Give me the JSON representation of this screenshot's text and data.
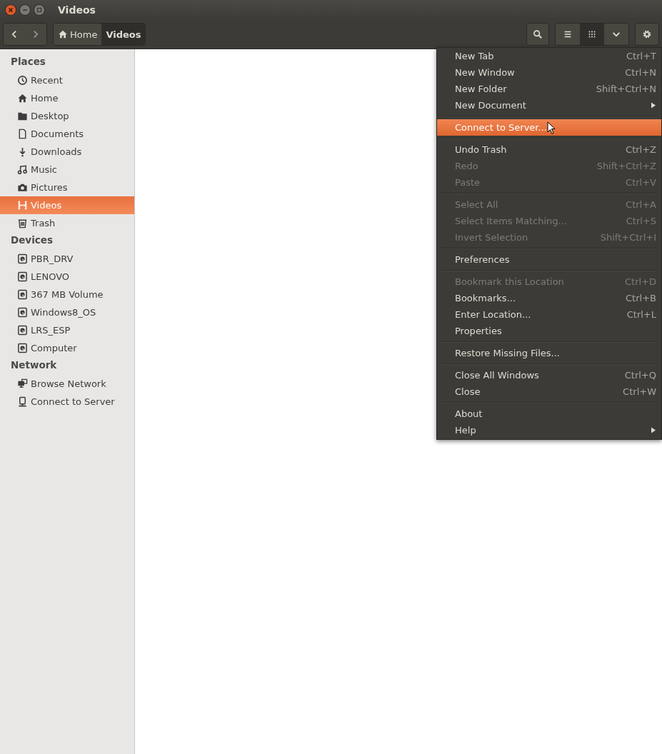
{
  "window": {
    "title": "Videos"
  },
  "toolbar": {
    "breadcrumbs": [
      {
        "label": "Home",
        "selected": false
      },
      {
        "label": "Videos",
        "selected": true
      }
    ],
    "view_buttons": [
      {
        "kind": "list",
        "selected": false
      },
      {
        "kind": "grid",
        "selected": true
      },
      {
        "kind": "chevron",
        "selected": false
      }
    ]
  },
  "sidebar": {
    "sections": [
      {
        "title": "Places",
        "items": [
          {
            "label": "Recent",
            "selected": false
          },
          {
            "label": "Home",
            "selected": false
          },
          {
            "label": "Desktop",
            "selected": false
          },
          {
            "label": "Documents",
            "selected": false
          },
          {
            "label": "Downloads",
            "selected": false
          },
          {
            "label": "Music",
            "selected": false
          },
          {
            "label": "Pictures",
            "selected": false
          },
          {
            "label": "Videos",
            "selected": true
          },
          {
            "label": "Trash",
            "selected": false
          }
        ]
      },
      {
        "title": "Devices",
        "items": [
          {
            "label": "PBR_DRV",
            "selected": false
          },
          {
            "label": "LENOVO",
            "selected": false
          },
          {
            "label": "367 MB Volume",
            "selected": false
          },
          {
            "label": "Windows8_OS",
            "selected": false
          },
          {
            "label": "LRS_ESP",
            "selected": false
          },
          {
            "label": "Computer",
            "selected": false
          }
        ]
      },
      {
        "title": "Network",
        "items": [
          {
            "label": "Browse Network",
            "selected": false
          },
          {
            "label": "Connect to Server",
            "selected": false
          }
        ]
      }
    ]
  },
  "menu": {
    "groups": [
      [
        {
          "label": "New Tab",
          "shortcut": "Ctrl+T",
          "disabled": false,
          "selected": false
        },
        {
          "label": "New Window",
          "shortcut": "Ctrl+N",
          "disabled": false,
          "selected": false
        },
        {
          "label": "New Folder",
          "shortcut": "Shift+Ctrl+N",
          "disabled": false,
          "selected": false
        },
        {
          "label": "New Document",
          "submenu": true,
          "disabled": false,
          "selected": false
        }
      ],
      [
        {
          "label": "Connect to Server...",
          "disabled": false,
          "selected": true
        }
      ],
      [
        {
          "label": "Undo Trash",
          "shortcut": "Ctrl+Z",
          "disabled": false,
          "selected": false
        },
        {
          "label": "Redo",
          "shortcut": "Shift+Ctrl+Z",
          "disabled": true,
          "selected": false
        },
        {
          "label": "Paste",
          "shortcut": "Ctrl+V",
          "disabled": true,
          "selected": false
        }
      ],
      [
        {
          "label": "Select All",
          "shortcut": "Ctrl+A",
          "disabled": true,
          "selected": false
        },
        {
          "label": "Select Items Matching...",
          "shortcut": "Ctrl+S",
          "disabled": true,
          "selected": false
        },
        {
          "label": "Invert Selection",
          "shortcut": "Shift+Ctrl+I",
          "disabled": true,
          "selected": false
        }
      ],
      [
        {
          "label": "Preferences",
          "disabled": false,
          "selected": false
        }
      ],
      [
        {
          "label": "Bookmark this Location",
          "shortcut": "Ctrl+D",
          "disabled": true,
          "selected": false
        },
        {
          "label": "Bookmarks...",
          "shortcut": "Ctrl+B",
          "disabled": false,
          "selected": false
        },
        {
          "label": "Enter Location...",
          "shortcut": "Ctrl+L",
          "disabled": false,
          "selected": false
        },
        {
          "label": "Properties",
          "disabled": false,
          "selected": false
        }
      ],
      [
        {
          "label": "Restore Missing Files...",
          "disabled": false,
          "selected": false
        }
      ],
      [
        {
          "label": "Close All Windows",
          "shortcut": "Ctrl+Q",
          "disabled": false,
          "selected": false
        },
        {
          "label": "Close",
          "shortcut": "Ctrl+W",
          "disabled": false,
          "selected": false
        }
      ],
      [
        {
          "label": "About",
          "disabled": false,
          "selected": false
        },
        {
          "label": "Help",
          "submenu": true,
          "disabled": false,
          "selected": false
        }
      ]
    ]
  }
}
